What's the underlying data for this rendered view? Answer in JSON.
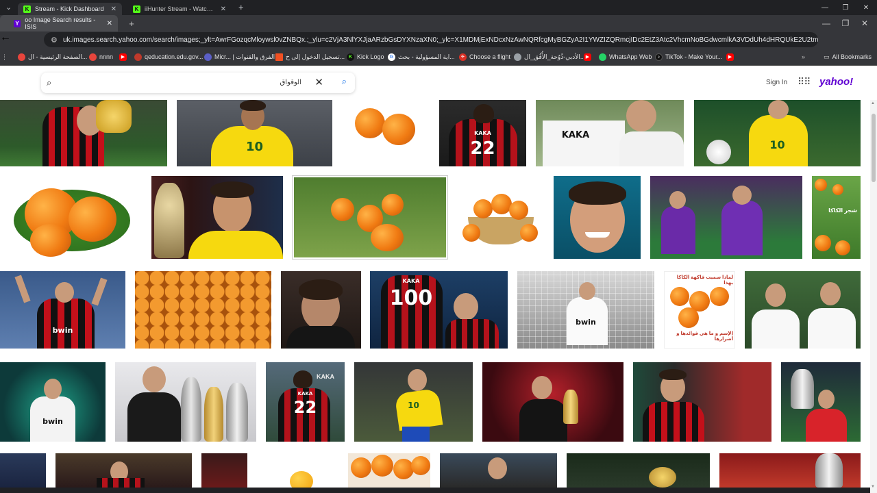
{
  "browser": {
    "tabs": [
      {
        "title": "Stream - Kick Dashboard",
        "favicon": "K"
      },
      {
        "title": "iiHunter Stream - Watch Live o",
        "favicon": "K"
      }
    ],
    "new_tab": "+",
    "active_tab": {
      "title": "oo Image Search results - ISIS",
      "favicon": "Y"
    },
    "url": "uk.images.search.yahoo.com/search/images;_ylt=AwrFGozqcMloywsl0vZNBQx.;_ylu=c2VjA3NlYXJjaARzbGsDYXNzaXN0;_ylc=X1MDMjExNDcxNzAwNQRfcgMyBGZyA2I1YWZIZQRmcjIDc2EtZ3Atc2VhcmNoBGdwcmlkA3VDdUh4dHRQUkE2U2tmZnVFckxSYUE",
    "bookmarks": [
      {
        "label": "الصفحة الرئيسية - ال...",
        "icon": "#e8453c"
      },
      {
        "label": "nnnn",
        "icon": "#e8453c"
      },
      {
        "label": "",
        "icon": "#ff0000"
      },
      {
        "label": "qeducation.edu.gov...",
        "icon": "#c0392b"
      },
      {
        "label": "Micr... | الفرق والقنوات",
        "icon": "#5b5fc7"
      },
      {
        "label": "تسجيل الدخول إلى ح...",
        "icon": "#f25022"
      },
      {
        "label": "Kick Logo",
        "icon": "#53fc18"
      },
      {
        "label": "اية المسؤولية - بحث...",
        "icon": "#ffffff"
      },
      {
        "label": "Choose a flight",
        "icon": "#d93025"
      },
      {
        "label": "الأدبي-ذُوٌحة_الأُفُق_ال...",
        "icon": "#9aa0a6"
      },
      {
        "label": "",
        "icon": "#ff0000"
      },
      {
        "label": "WhatsApp Web",
        "icon": "#25d366"
      },
      {
        "label": "TikTok - Make Your...",
        "icon": "#111111"
      },
      {
        "label": "",
        "icon": "#ff0000"
      }
    ],
    "all_bookmarks": "All Bookmarks"
  },
  "yahoo": {
    "query": "الوقواق",
    "sign_in": "Sign In",
    "logo": "yahoo!",
    "accent": "#6001d2"
  },
  "images": {
    "row1": [
      "kaka-kissing-trophy",
      "kaka-brazil-jersey",
      "persimmons",
      "kaka-22-back",
      "kaka-holding-jersey",
      "kaka-brazil-ball"
    ],
    "jersey_texts": {
      "kaka_22": "22",
      "kaka_name": "KAKA",
      "brazil_10": "10",
      "milan_100": "100",
      "bwin": "bwin",
      "arabic_caption_top": "لماذا سميت فاكهة الكاكا بهذا",
      "arabic_caption_bottom": "الإسم و ما هي فوائدها و أضرارها",
      "tree_caption": "شجر الكاكا"
    }
  }
}
